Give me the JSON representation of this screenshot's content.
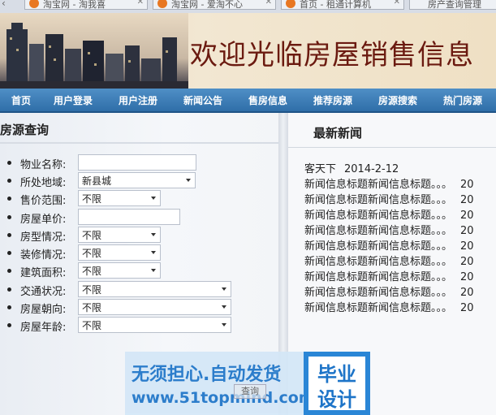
{
  "browser": {
    "tabs": [
      {
        "title": "淘宝网 - 淘我喜"
      },
      {
        "title": "淘宝网 - 爱淘不心"
      },
      {
        "title": "首页 - 租通计算机"
      },
      {
        "title": "房产查询管理"
      }
    ]
  },
  "header": {
    "title": "欢迎光临房屋销售信息"
  },
  "nav": {
    "items": [
      "首页",
      "用户登录",
      "用户注册",
      "新闻公告",
      "售房信息",
      "推荐房源",
      "房源搜索",
      "热门房源"
    ]
  },
  "search_panel": {
    "heading": "房源查询",
    "fields": {
      "name": {
        "label": "物业名称:",
        "value": ""
      },
      "location": {
        "label": "所处地域:",
        "value": "新县城"
      },
      "price_range": {
        "label": "售价范围:",
        "value": "不限"
      },
      "unit_price": {
        "label": "房屋单价:",
        "value": ""
      },
      "layout": {
        "label": "房型情况:",
        "value": "不限"
      },
      "decoration": {
        "label": "装修情况:",
        "value": "不限"
      },
      "area": {
        "label": "建筑面积:",
        "value": "不限"
      },
      "traffic": {
        "label": "交通状况:",
        "value": "不限"
      },
      "orientation": {
        "label": "房屋朝向:",
        "value": "不限"
      },
      "age": {
        "label": "房屋年龄:",
        "value": "不限"
      }
    },
    "search_button": "查询"
  },
  "news_panel": {
    "heading": "最新新闻",
    "items": [
      {
        "title": "客天下",
        "date": "2014-2-12"
      },
      {
        "title": "新闻信息标题新闻信息标题。。。",
        "date": "20"
      },
      {
        "title": "新闻信息标题新闻信息标题。。。",
        "date": "20"
      },
      {
        "title": "新闻信息标题新闻信息标题。。。",
        "date": "20"
      },
      {
        "title": "新闻信息标题新闻信息标题。。。",
        "date": "20"
      },
      {
        "title": "新闻信息标题新闻信息标题。。。",
        "date": "20"
      },
      {
        "title": "新闻信息标题新闻信息标题。。。",
        "date": "20"
      },
      {
        "title": "新闻信息标题新闻信息标题。。。",
        "date": "20"
      },
      {
        "title": "新闻信息标题新闻信息标题。。。",
        "date": "20"
      },
      {
        "title": "新闻信息标题新闻信息标题。。。",
        "date": "20"
      }
    ]
  },
  "watermark": {
    "line1": "无须担心.自动发货",
    "line2": "www.51topmind.com",
    "badge_line1": "毕业",
    "badge_line2": "设计"
  }
}
